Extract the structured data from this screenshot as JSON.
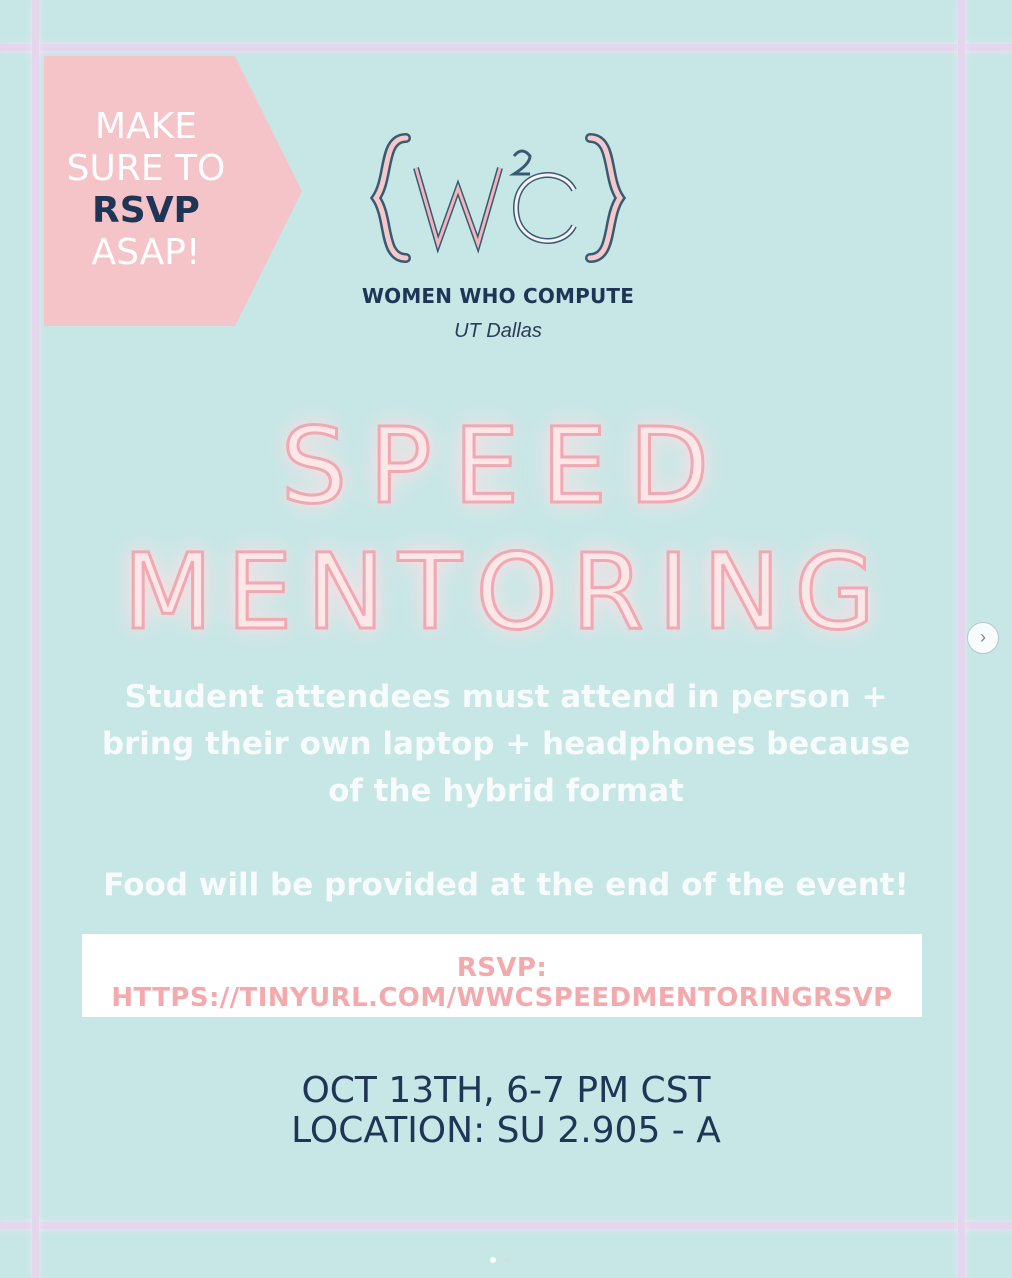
{
  "banner": {
    "line1": "MAKE",
    "line2": "SURE TO",
    "line3": "RSVP",
    "line4": "ASAP!"
  },
  "logo": {
    "mark": "{W²C}",
    "org_name": "WOMEN WHO COMPUTE",
    "subtitle": "UT Dallas"
  },
  "headline": {
    "line1": "SPEED",
    "line2": "MENTORING"
  },
  "body": {
    "paragraph1": "Student attendees must attend in person + bring their own laptop + headphones because of the hybrid format",
    "paragraph2": "Food will be provided at the end of the event!"
  },
  "rsvp": {
    "link_text": "RSVP: HTTPS://TINYURL.COM/WWCSPEEDMENTORINGRSVP"
  },
  "event": {
    "date": "OCT 13TH, 6-7 PM CST",
    "location": "LOCATION: SU 2.905 - A"
  },
  "carousel": {
    "next_icon": "chevron-right-icon",
    "next_glyph": "›",
    "active_index": 0,
    "total": 2
  },
  "colors": {
    "background": "#c7e6e6",
    "banner": "#f4c4c8",
    "navy": "#1f3556",
    "pink": "#f4a9ad"
  }
}
